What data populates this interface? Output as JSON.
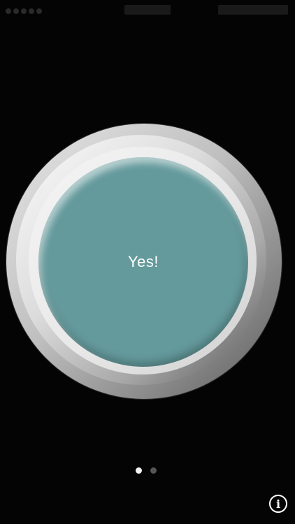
{
  "button": {
    "label": "Yes!",
    "color": "#649a9c"
  },
  "pager": {
    "page_count": 2,
    "current_page": 1
  },
  "info": {
    "glyph": "i",
    "icon": "info-icon"
  },
  "colors": {
    "background": "#040404",
    "ring_light": "#e6e6e6",
    "ring_dark": "#5a5a5a",
    "dot_active": "#f2f2f2",
    "dot_inactive": "#555555"
  }
}
